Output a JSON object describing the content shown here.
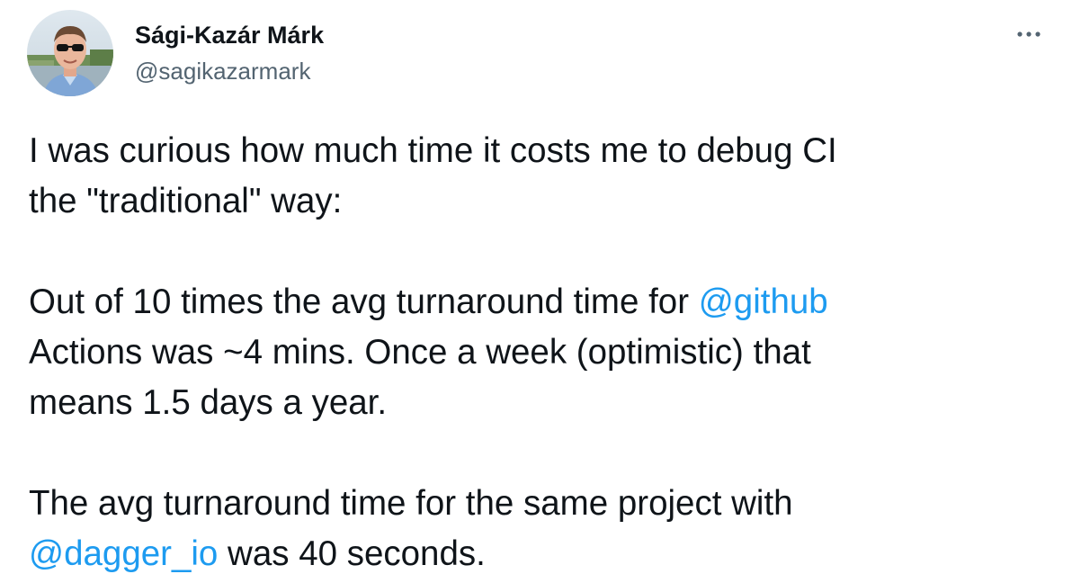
{
  "author": {
    "display_name": "Sági-Kazár Márk",
    "handle": "@sagikazarmark"
  },
  "icons": {
    "more": "more-horizontal-icon",
    "avatar": "profile-photo"
  },
  "colors": {
    "text": "#0f1419",
    "secondary": "#536471",
    "link": "#1d9bf0"
  },
  "tweet": {
    "p1": {
      "line1": "I was curious how much time it costs me to debug CI",
      "line2": "the \"traditional\" way:"
    },
    "p2": {
      "line1_text": "Out of 10 times the avg turnaround time for ",
      "mention_github": "@github",
      "line2": "Actions was ~4 mins. Once a week (optimistic) that",
      "line3": "means 1.5 days a year."
    },
    "p3": {
      "line1": "The avg turnaround time for the same project with",
      "mention_dagger": "@dagger_io",
      "line2_rest": " was 40 seconds."
    }
  }
}
